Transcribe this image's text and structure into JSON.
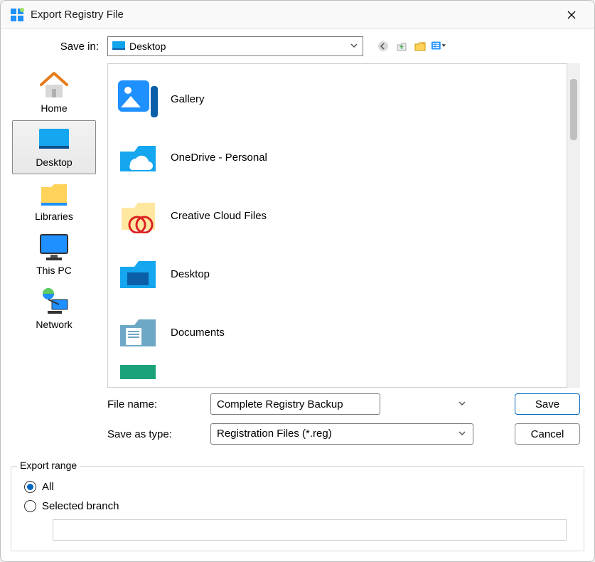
{
  "window": {
    "title": "Export Registry File"
  },
  "savein": {
    "label": "Save in:",
    "value": "Desktop"
  },
  "toolbar": {
    "back": "back",
    "up": "up",
    "newfolder": "new-folder",
    "views": "views"
  },
  "sidebar": {
    "items": [
      {
        "label": "Home"
      },
      {
        "label": "Desktop"
      },
      {
        "label": "Libraries"
      },
      {
        "label": "This PC"
      },
      {
        "label": "Network"
      }
    ],
    "selected_index": 1
  },
  "files": {
    "items": [
      {
        "label": "Gallery"
      },
      {
        "label": "OneDrive - Personal"
      },
      {
        "label": "Creative Cloud Files"
      },
      {
        "label": "Desktop"
      },
      {
        "label": "Documents"
      }
    ]
  },
  "form": {
    "filename_label": "File name:",
    "filename_value": "Complete Registry Backup",
    "savetype_label": "Save as type:",
    "savetype_value": "Registration Files (*.reg)",
    "save_btn": "Save",
    "cancel_btn": "Cancel"
  },
  "export": {
    "legend": "Export range",
    "all_label": "All",
    "selected_label": "Selected branch",
    "selected_value": "",
    "choice": "all"
  }
}
